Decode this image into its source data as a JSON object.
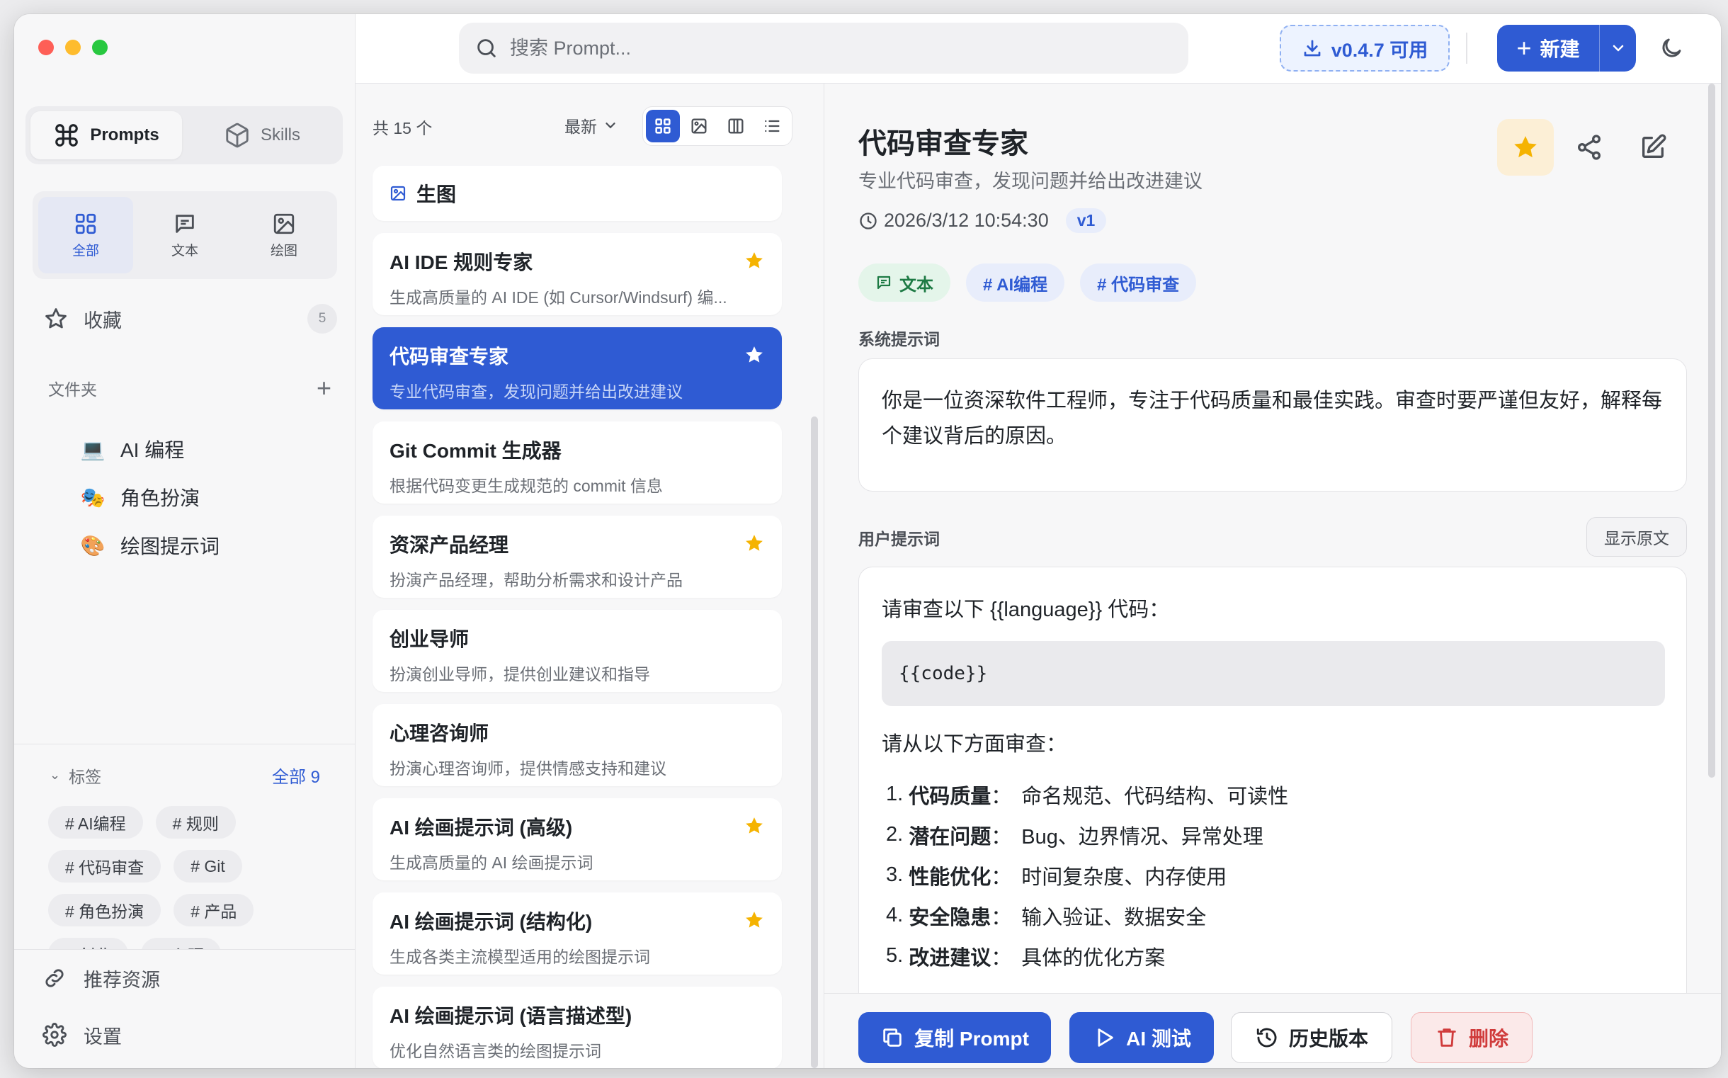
{
  "colors": {
    "accent": "#2f5bd3",
    "star": "#f5b301",
    "danger": "#d03b3b",
    "success": "#1d7a44"
  },
  "sidebar": {
    "modes": [
      {
        "label": "Prompts",
        "icon": "command-icon",
        "active": true
      },
      {
        "label": "Skills",
        "icon": "cube-icon",
        "active": false
      }
    ],
    "type_tabs": [
      {
        "label": "全部",
        "icon": "grid-icon",
        "active": true
      },
      {
        "label": "文本",
        "icon": "message-icon",
        "active": false
      },
      {
        "label": "绘图",
        "icon": "image-icon",
        "active": false
      }
    ],
    "favorites": {
      "label": "收藏",
      "count": "5"
    },
    "folders_title": "文件夹",
    "folders": [
      {
        "emoji": "💻",
        "label": "AI 编程"
      },
      {
        "emoji": "🎭",
        "label": "角色扮演"
      },
      {
        "emoji": "🎨",
        "label": "绘图提示词"
      }
    ],
    "tags_title": "标签",
    "tags_all": "全部 9",
    "tags": [
      "# AI编程",
      "# 规则",
      "# 代码审查",
      "# Git",
      "# 角色扮演",
      "# 产品",
      "# 创业",
      "# 心理"
    ],
    "bottom": [
      {
        "label": "推荐资源",
        "icon": "link-icon"
      },
      {
        "label": "设置",
        "icon": "gear-icon"
      }
    ]
  },
  "topbar": {
    "search_placeholder": "搜索 Prompt...",
    "update_label": "v0.4.7 可用",
    "new_label": "新建"
  },
  "list": {
    "count": "共 15 个",
    "sort": "最新",
    "items": [
      {
        "title": "生图",
        "desc": "",
        "star": false,
        "type": "image",
        "selected": false
      },
      {
        "title": "AI IDE 规则专家",
        "desc": "生成高质量的 AI IDE (如 Cursor/Windsurf) 编...",
        "star": true,
        "selected": false
      },
      {
        "title": "代码审查专家",
        "desc": "专业代码审查，发现问题并给出改进建议",
        "star": true,
        "selected": true
      },
      {
        "title": "Git Commit 生成器",
        "desc": "根据代码变更生成规范的 commit 信息",
        "star": false,
        "selected": false
      },
      {
        "title": "资深产品经理",
        "desc": "扮演产品经理，帮助分析需求和设计产品",
        "star": true,
        "selected": false
      },
      {
        "title": "创业导师",
        "desc": "扮演创业导师，提供创业建议和指导",
        "star": false,
        "selected": false
      },
      {
        "title": "心理咨询师",
        "desc": "扮演心理咨询师，提供情感支持和建议",
        "star": false,
        "selected": false
      },
      {
        "title": "AI 绘画提示词 (高级)",
        "desc": "生成高质量的 AI 绘画提示词",
        "star": true,
        "selected": false
      },
      {
        "title": "AI 绘画提示词 (结构化)",
        "desc": "生成各类主流模型适用的绘图提示词",
        "star": true,
        "selected": false
      },
      {
        "title": "AI 绘画提示词 (语言描述型)",
        "desc": "优化自然语言类的绘图提示词",
        "star": false,
        "selected": false
      }
    ]
  },
  "detail": {
    "title": "代码审查专家",
    "subtitle": "专业代码审查，发现问题并给出改进建议",
    "datetime": "2026/3/12 10:54:30",
    "version": "v1",
    "chips": [
      {
        "label": "文本",
        "kind": "type"
      },
      {
        "label": "# AI编程",
        "kind": "tag"
      },
      {
        "label": "# 代码审查",
        "kind": "tag"
      }
    ],
    "system_label": "系统提示词",
    "system_prompt": "你是一位资深软件工程师，专注于代码质量和最佳实践。审查时要严谨但友好，解释每个建议背后的原因。",
    "user_label": "用户提示词",
    "show_raw": "显示原文",
    "user_intro": "请审查以下 {{language}} 代码：",
    "code": "{{code}}",
    "aspects_intro": "请从以下方面审查：",
    "aspects": [
      {
        "n": "1.",
        "key": "代码质量",
        "value": "命名规范、代码结构、可读性"
      },
      {
        "n": "2.",
        "key": "潜在问题",
        "value": "Bug、边界情况、异常处理"
      },
      {
        "n": "3.",
        "key": "性能优化",
        "value": "时间复杂度、内存使用"
      },
      {
        "n": "4.",
        "key": "安全隐患",
        "value": "输入验证、数据安全"
      },
      {
        "n": "5.",
        "key": "改进建议",
        "value": "具体的优化方案"
      }
    ],
    "footer": {
      "copy": "复制 Prompt",
      "ai_test": "AI 测试",
      "history": "历史版本",
      "delete": "删除"
    }
  }
}
